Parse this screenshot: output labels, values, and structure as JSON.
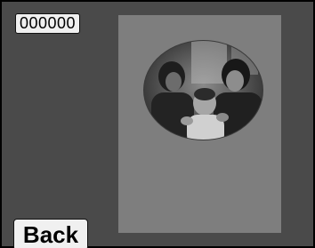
{
  "counter": {
    "value": "000000"
  },
  "actions": {
    "back_label": "Back"
  },
  "photo": {
    "shape": "oval-vignette",
    "tone": "grayscale"
  },
  "colors": {
    "screen_bg": "#4a4a4a",
    "preview_panel": "#7e7e7e",
    "button_face": "#f0f0f0",
    "border": "#000000"
  }
}
